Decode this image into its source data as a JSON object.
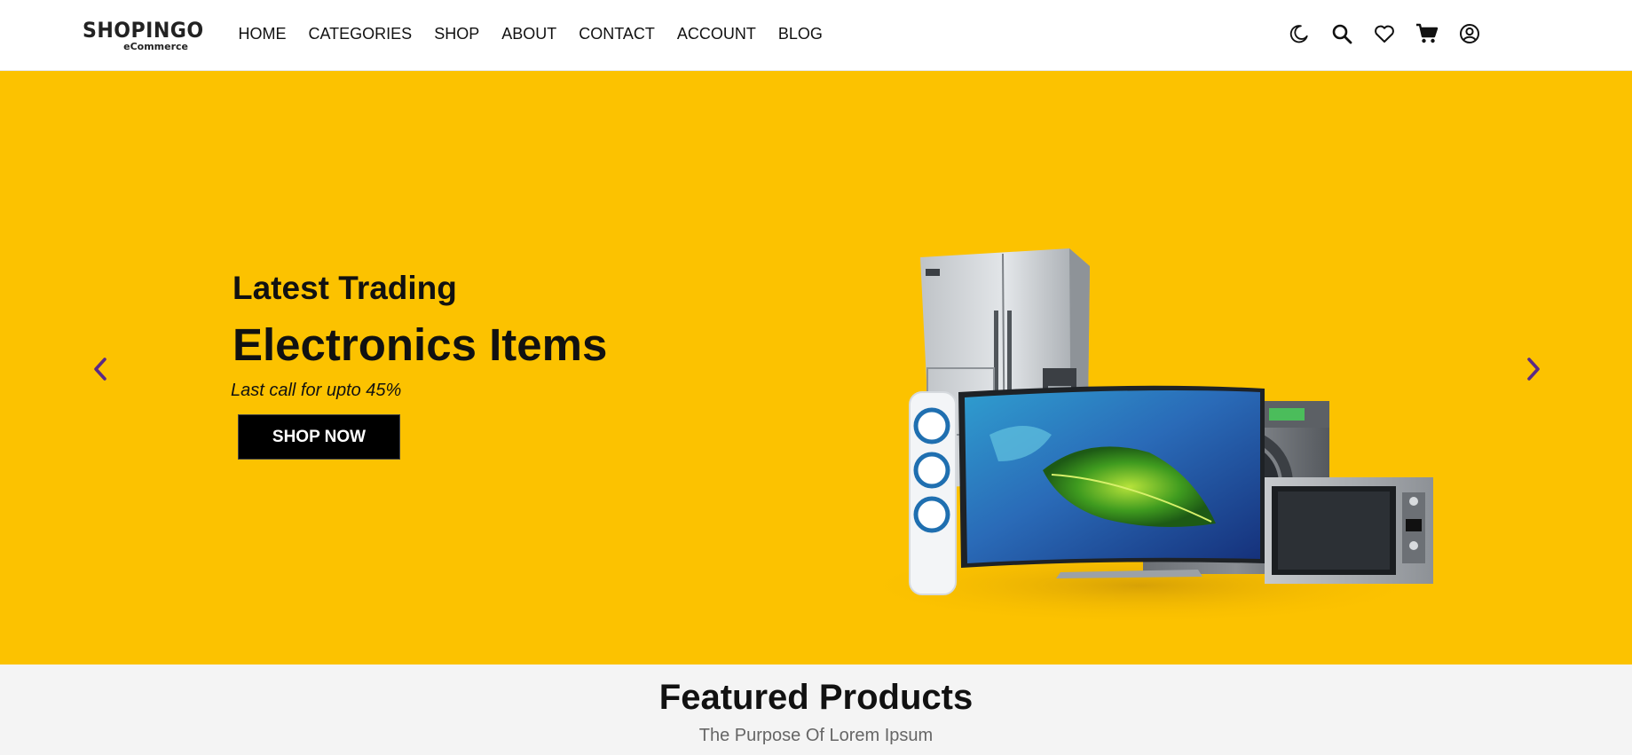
{
  "brand": {
    "name": "SHOPINGO",
    "tagline": "eCommerce"
  },
  "nav": {
    "items": [
      {
        "label": "HOME"
      },
      {
        "label": "CATEGORIES"
      },
      {
        "label": "SHOP"
      },
      {
        "label": "ABOUT"
      },
      {
        "label": "CONTACT"
      },
      {
        "label": "ACCOUNT"
      },
      {
        "label": "BLOG"
      }
    ]
  },
  "header_icons": [
    "moon-icon",
    "search-icon",
    "heart-icon",
    "cart-icon",
    "user-icon"
  ],
  "hero": {
    "subtitle": "Latest Trading",
    "title": "Electronics Items",
    "offer": "Last call for upto 45%",
    "button_label": "SHOP NOW",
    "background_color": "#fcc200",
    "arrow_color": "#5b2a86",
    "image": "electronics-appliances-group"
  },
  "featured": {
    "title": "Featured Products",
    "subtitle": "The Purpose Of Lorem Ipsum",
    "background_color": "#f4f4f4"
  }
}
